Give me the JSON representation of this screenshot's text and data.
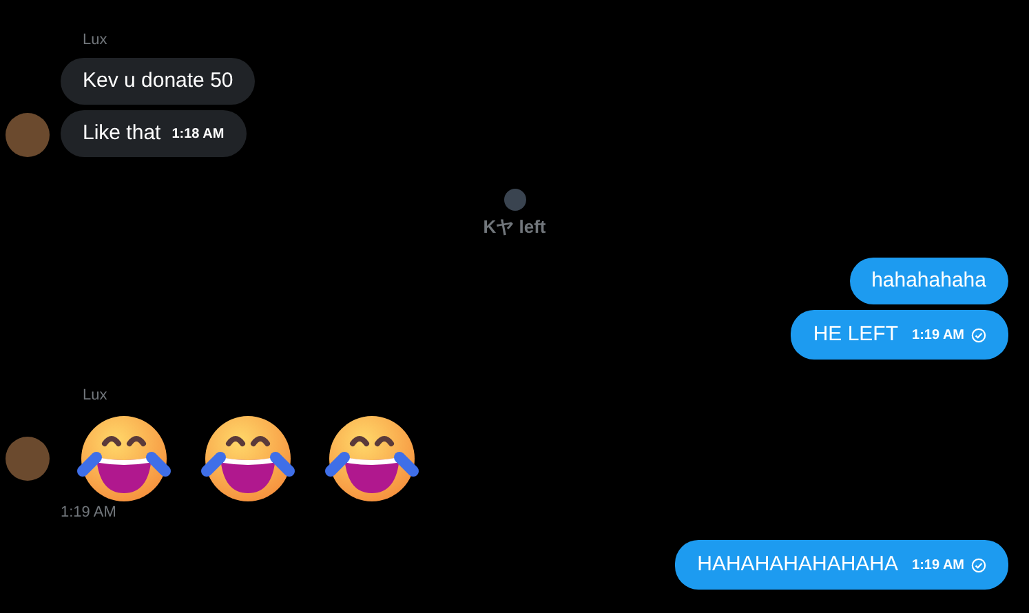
{
  "messages": [
    {
      "kind": "incoming",
      "sender": "Lux",
      "bubbles": [
        {
          "text": "Kev u donate 50"
        },
        {
          "text": "Like that",
          "time": "1:18 AM"
        }
      ]
    },
    {
      "kind": "event",
      "text": "Kヤ left"
    },
    {
      "kind": "outgoing",
      "bubbles": [
        {
          "text": "hahahahaha"
        },
        {
          "text": "HE LEFT",
          "time": "1:19 AM",
          "delivered": true
        }
      ]
    },
    {
      "kind": "emoji",
      "sender": "Lux",
      "emojis": [
        {
          "kind": "laughing"
        },
        {
          "kind": "laughing"
        },
        {
          "kind": "laughing"
        }
      ],
      "time": "1:19 AM"
    },
    {
      "kind": "outgoing",
      "bubbles": [
        {
          "text": "HAHAHAHAHAHAHA",
          "time": "1:19 AM",
          "delivered": true
        }
      ]
    }
  ]
}
